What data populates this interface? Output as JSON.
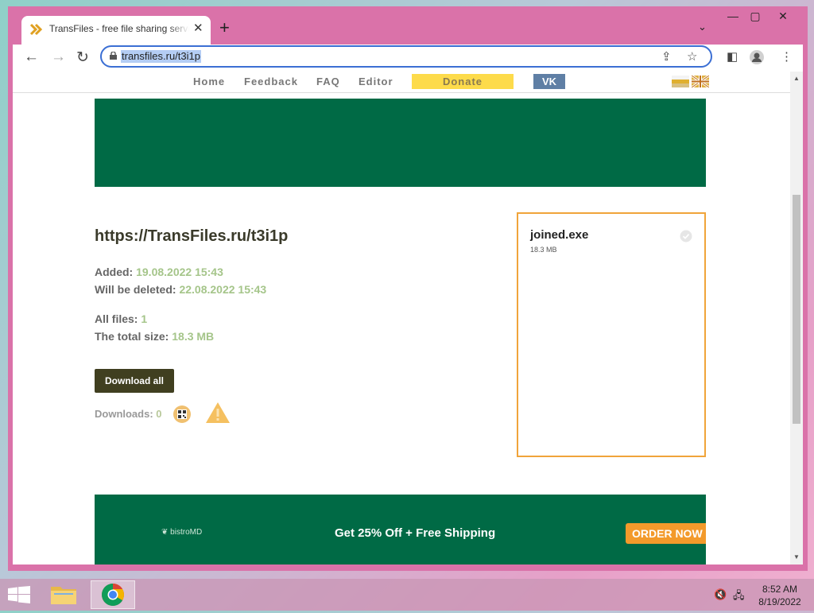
{
  "browser": {
    "tab_title": "TransFiles - free file sharing service",
    "tab_close": "✕",
    "new_tab": "+",
    "tab_list": "⌄",
    "url": "transfiles.ru/t3i1p",
    "window_controls": {
      "minimize": "—",
      "restore": "▢",
      "close": "✕"
    }
  },
  "site_nav": {
    "items": [
      "Home",
      "Feedback",
      "FAQ",
      "Editor"
    ],
    "donate": "Donate",
    "vk": "VK"
  },
  "share": {
    "link": "https://TransFiles.ru/t3i1p",
    "added_label": "Added:",
    "added_value": "19.08.2022 15:43",
    "deleted_label": "Will be deleted:",
    "deleted_value": "22.08.2022 15:43",
    "files_label": "All files:",
    "files_value": "1",
    "size_label": "The total size:",
    "size_value": "18.3 MB",
    "download_all": "Download all",
    "downloads_label": "Downloads:",
    "downloads_value": "0"
  },
  "file": {
    "name": "joined.exe",
    "size": "18.3 MB"
  },
  "ad": {
    "brand": "bistroMD",
    "offer": "Get 25% Off + Free Shipping",
    "cta": "ORDER NOW"
  },
  "taskbar": {
    "time": "8:52 AM",
    "date": "8/19/2022"
  },
  "colors": {
    "accent_green": "#006a45",
    "highlight": "#a5c58a",
    "border_orange": "#f0a43a"
  }
}
